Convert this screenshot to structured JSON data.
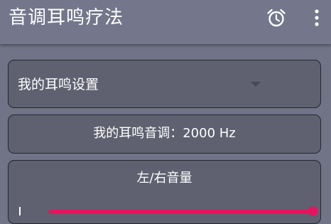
{
  "app": {
    "title": "音调耳鸣疗法"
  },
  "toolbar": {
    "alarm_icon": "alarm-clock-icon",
    "more_icon": "more-vert-icon"
  },
  "settings": {
    "dropdown_value": "我的耳鸣设置",
    "tone_label": "我的耳鸣音调：2000 Hz",
    "volume_label": "左/右音量",
    "volume_balance": 1.0
  },
  "colors": {
    "background": "#717387",
    "appbar": "#74778b",
    "card": "#5f6170",
    "card_border": "#25262e",
    "accent": "#e4145e",
    "text": "#ffffff"
  }
}
